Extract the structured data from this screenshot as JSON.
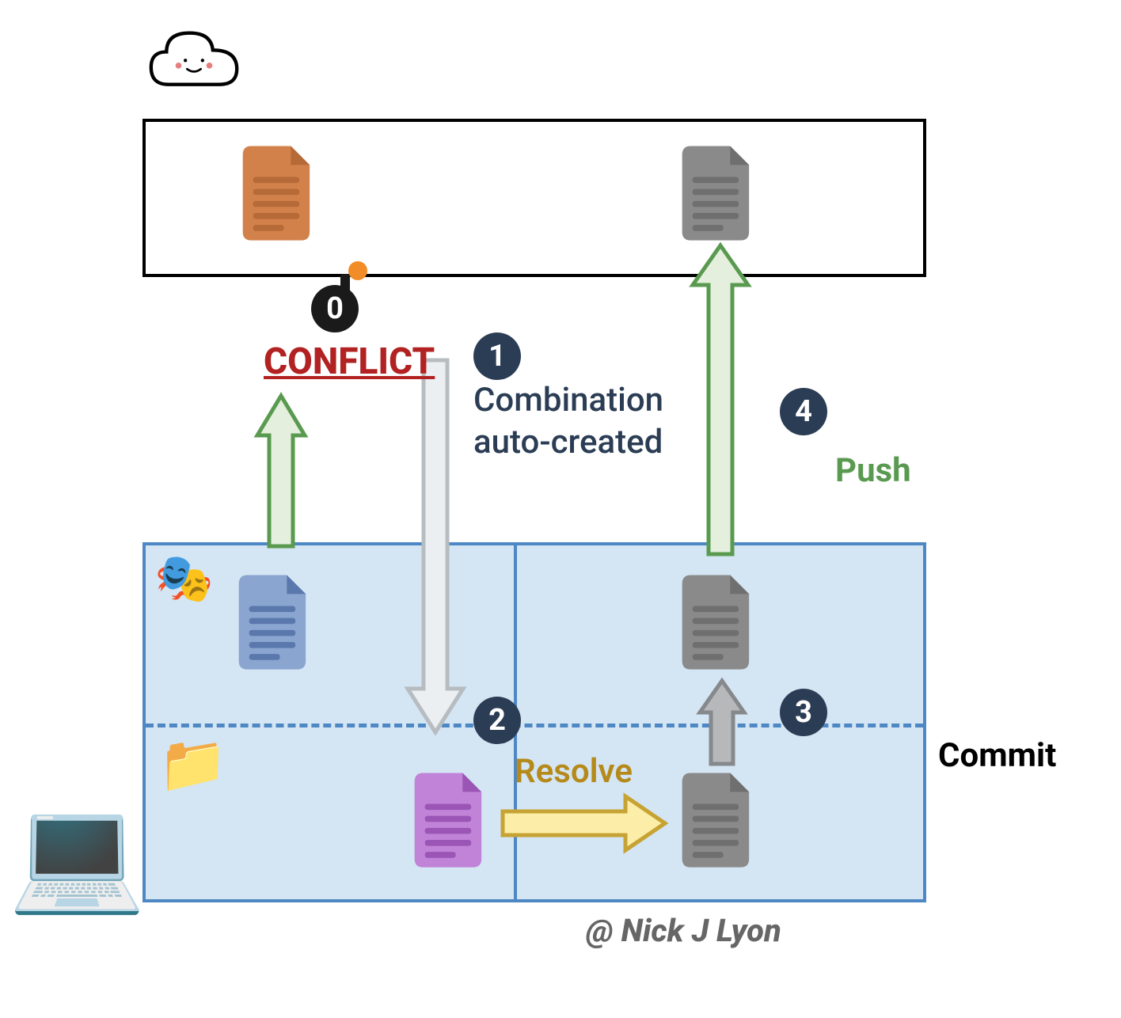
{
  "labels": {
    "conflict": "CONFLICT",
    "combination": "Combination auto-created",
    "resolve": "Resolve",
    "commit": "Commit",
    "push": "Push",
    "attribution": "@ Nick J Lyon"
  },
  "steps": {
    "s0": "0",
    "s1": "1",
    "s2": "2",
    "s3": "3",
    "s4": "4"
  },
  "colors": {
    "file_orange": "#d2814a",
    "file_gray": "#8a8a8a",
    "file_blue": "#6a8bc4",
    "file_purple": "#b061c9",
    "arrow_green_fill": "#e4f0dd",
    "arrow_green_stroke": "#5a9a50",
    "arrow_lightgray_fill": "#eceff1",
    "arrow_lightgray_stroke": "#b6bcc0",
    "arrow_gray_fill": "#b6b8ba",
    "arrow_gray_stroke": "#86898c",
    "arrow_yellow_fill": "#fceea8",
    "arrow_yellow_stroke": "#c6a332",
    "box_blue_fill": "#d4e5f4",
    "box_blue_stroke": "#4d88c4"
  },
  "diagram": {
    "type": "flow",
    "description": "Git merge conflict resolution workflow between remote (cloud) and local repository",
    "nodes": [
      {
        "id": "remote-file-orig",
        "loc": "cloud",
        "color": "orange"
      },
      {
        "id": "remote-file-pushed",
        "loc": "cloud",
        "color": "gray"
      },
      {
        "id": "local-staged-file",
        "loc": "local-staged",
        "color": "blue"
      },
      {
        "id": "local-merged-file",
        "loc": "local-working",
        "color": "purple"
      },
      {
        "id": "local-resolved-file",
        "loc": "local-working",
        "color": "gray"
      },
      {
        "id": "local-committed-file",
        "loc": "local-staged",
        "color": "gray"
      }
    ],
    "edges": [
      {
        "from": "local-staged-file",
        "to": "remote-file-orig",
        "label": "CONFLICT",
        "step": 0,
        "color": "green"
      },
      {
        "from": "remote-file-orig",
        "to": "local-merged-file",
        "label": "Combination auto-created",
        "step": 1,
        "color": "lightgray"
      },
      {
        "from": "local-merged-file",
        "to": "local-resolved-file",
        "label": "Resolve",
        "step": 2,
        "color": "yellow"
      },
      {
        "from": "local-resolved-file",
        "to": "local-committed-file",
        "label": "Commit",
        "step": 3,
        "color": "gray"
      },
      {
        "from": "local-committed-file",
        "to": "remote-file-pushed",
        "label": "Push",
        "step": 4,
        "color": "green"
      }
    ]
  }
}
